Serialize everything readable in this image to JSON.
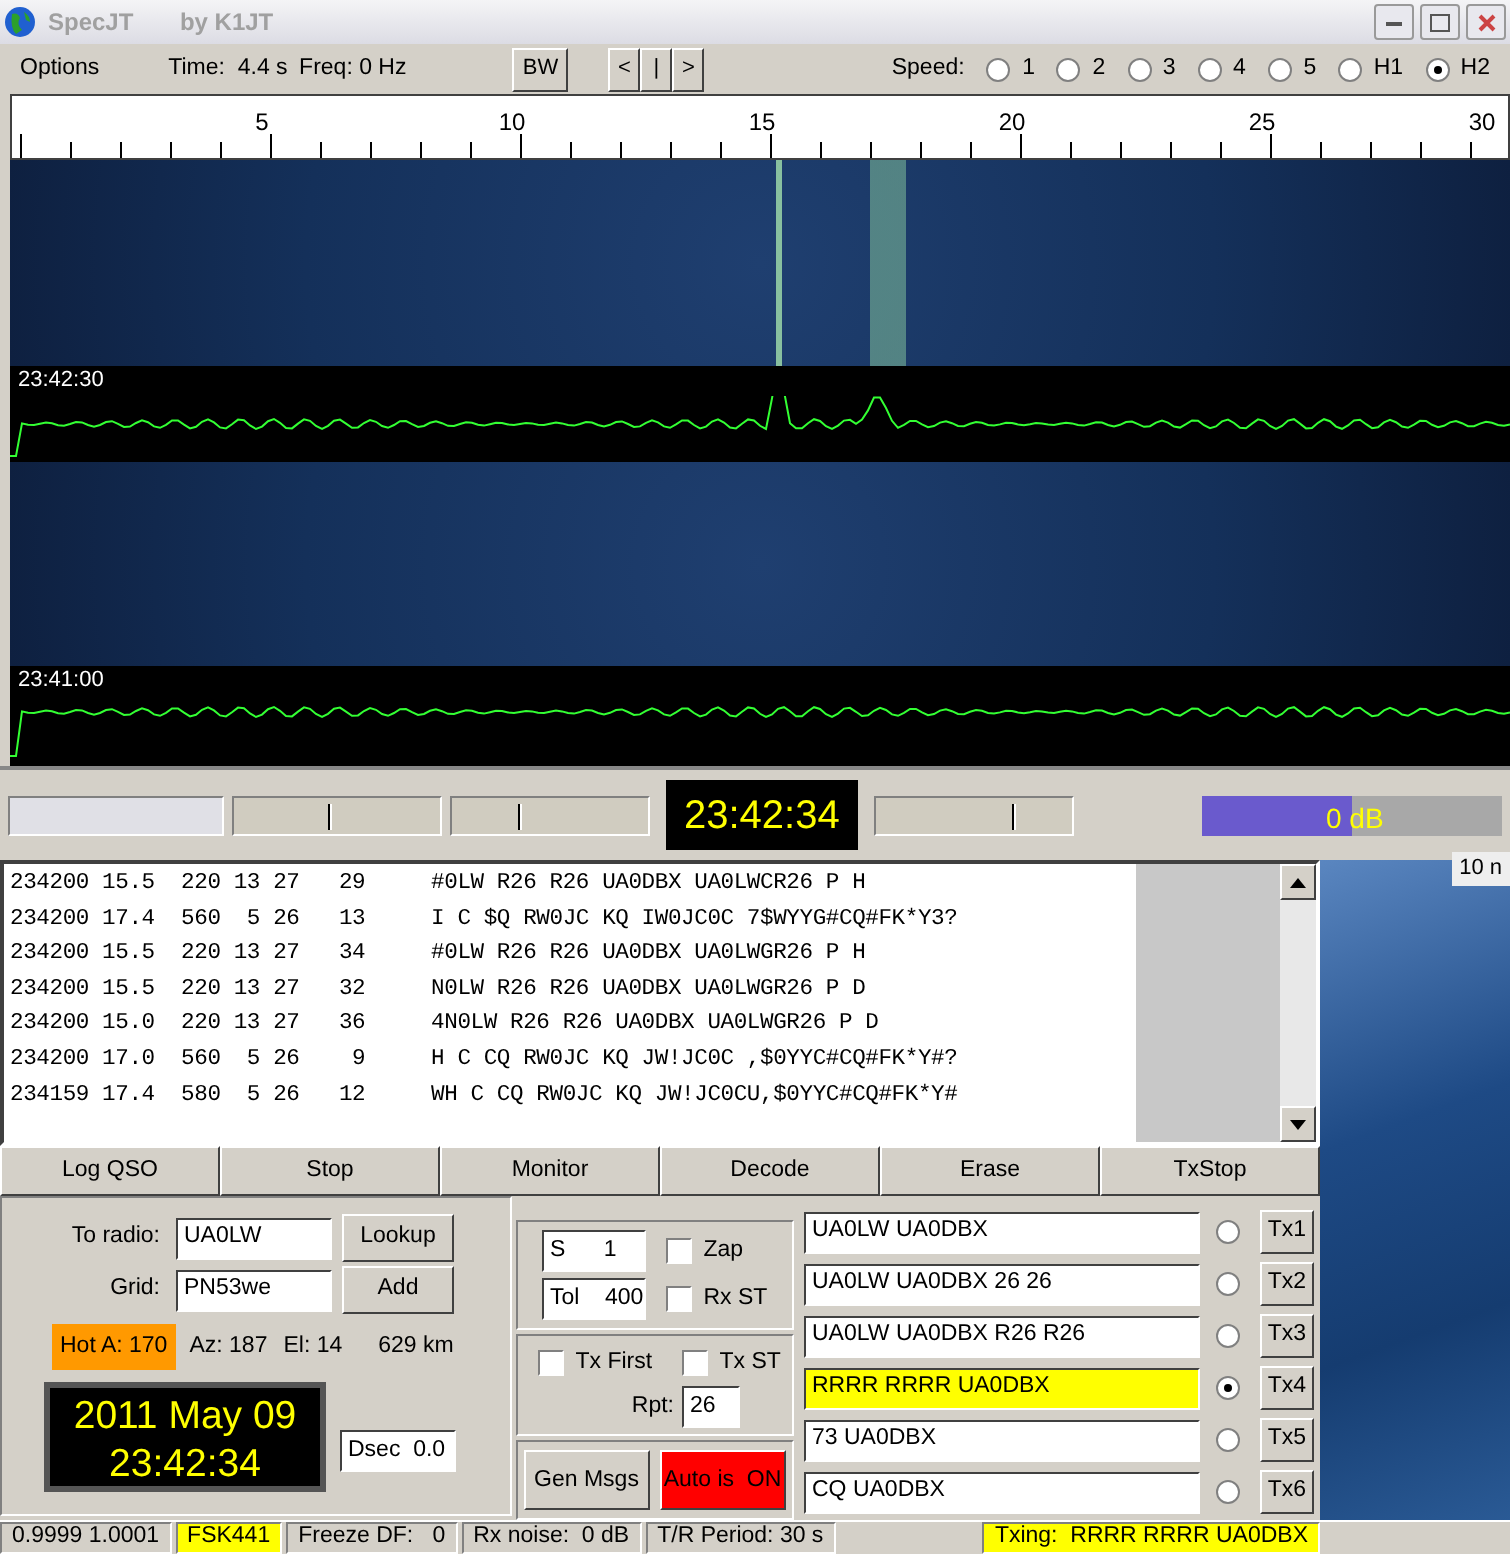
{
  "window": {
    "title": "SpecJT",
    "subtitle": "by K1JT"
  },
  "toolbar": {
    "menu": "Options",
    "time": "Time:  4.4 s",
    "freq": "Freq: 0 Hz",
    "bw_button": "BW",
    "nav_buttons": [
      "<",
      "|",
      ">"
    ],
    "speed_label": "Speed:",
    "speeds": [
      {
        "label": "1",
        "selected": false
      },
      {
        "label": "2",
        "selected": false
      },
      {
        "label": "3",
        "selected": false
      },
      {
        "label": "4",
        "selected": false
      },
      {
        "label": "5",
        "selected": false
      },
      {
        "label": "H1",
        "selected": false
      },
      {
        "label": "H2",
        "selected": true
      }
    ]
  },
  "ruler": {
    "ticks": [
      "5",
      "10",
      "15",
      "20",
      "25",
      "30"
    ]
  },
  "waterfall": {
    "timestamps": [
      "23:42:30",
      "23:41:00"
    ]
  },
  "controls": {
    "sliders": [
      {
        "level": 0.46
      },
      {
        "level": 0.34
      }
    ],
    "clock": "23:42:34",
    "slider_right": {
      "level": 0.7
    },
    "meter": {
      "level": 0.5,
      "reading": "0 dB"
    }
  },
  "decodes": [
    "234200 15.5  220 13 27   29     #0LW R26 R26 UA0DBX UA0LWCR26 P H",
    "234200 17.4  560  5 26   13     I C $Q RW0JC KQ IW0JC0C 7$WYYG#CQ#FK*Y3?",
    "234200 15.5  220 13 27   34     #0LW R26 R26 UA0DBX UA0LWGR26 P H",
    "234200 15.5  220 13 27   32     N0LW R26 R26 UA0DBX UA0LWGR26 P D",
    "234200 15.0  220 13 27   36     4N0LW R26 R26 UA0DBX UA0LWGR26 P D",
    "234200 17.0  560  5 26    9     H C CQ RW0JC KQ JW!JC0C ,$0YYC#CQ#FK*Y#?",
    "234159 17.4  580  5 26   12     WH C CQ RW0JC KQ JW!JC0CU,$0YYC#CQ#FK*Y#"
  ],
  "buttons": [
    "Log QSO",
    "Stop",
    "Monitor",
    "Decode",
    "Erase",
    "TxStop"
  ],
  "station": {
    "to_radio_label": "To radio:",
    "to_radio": "UA0LW",
    "grid_label": "Grid:",
    "grid": "PN53we",
    "lookup_button": "Lookup",
    "add_button": "Add",
    "hot_a": "Hot A: 170",
    "az": "Az: 187",
    "el": "El: 14",
    "distance": "629 km",
    "date": "2011 May 09",
    "time": "23:42:34",
    "dsec": "Dsec  0.0"
  },
  "options": {
    "s_field": "S      1",
    "tol_field": "Tol    400",
    "checks": [
      {
        "label": "Zap",
        "checked": false
      },
      {
        "label": "Rx ST",
        "checked": false
      },
      {
        "label": "Tx First",
        "checked": false
      },
      {
        "label": "Tx ST",
        "checked": false
      }
    ],
    "rpt_label": "Rpt:",
    "rpt": "26",
    "gen_button": "Gen Msgs",
    "auto_button": {
      "label": "Auto is  ON",
      "on": true
    }
  },
  "tx_messages": [
    {
      "text": "UA0LW UA0DBX",
      "selected": false,
      "button": "Tx1"
    },
    {
      "text": "UA0LW UA0DBX 26 26",
      "selected": false,
      "button": "Tx2"
    },
    {
      "text": "UA0LW UA0DBX R26 R26",
      "selected": false,
      "button": "Tx3"
    },
    {
      "text": "RRRR RRRR UA0DBX",
      "selected": true,
      "button": "Tx4"
    },
    {
      "text": "73 UA0DBX",
      "selected": false,
      "button": "Tx5"
    },
    {
      "text": "CQ UA0DBX",
      "selected": false,
      "button": "Tx6"
    }
  ],
  "desktop": {
    "text": "10 n"
  },
  "status_bar": {
    "fields": [
      "0.9999 1.0001",
      "FSK441",
      "Freeze DF:   0",
      "Rx noise:  0 dB",
      "T/R Period: 30 s"
    ],
    "highlighted": [
      false,
      true,
      false,
      false,
      false
    ],
    "txing": "Txing:  RRRR RRRR UA0DBX"
  }
}
